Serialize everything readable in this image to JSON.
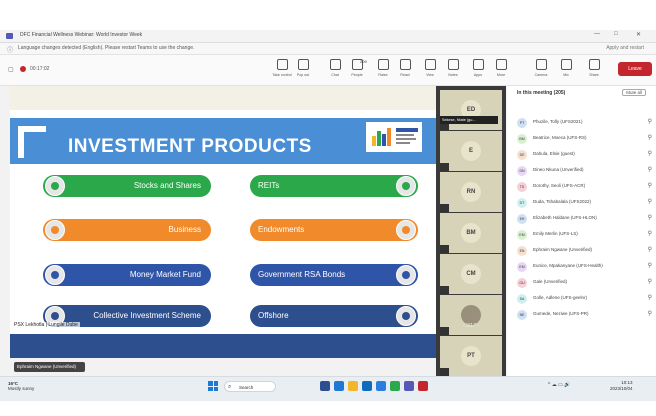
{
  "window": {
    "title": "DFC Financial Wellness Webinar: World Investor Week",
    "controls": [
      "—",
      "□",
      "✕"
    ]
  },
  "notice": {
    "text": "Language changes detected (English). Please restart Teams to use the change.",
    "action": "Apply and restart"
  },
  "meeting": {
    "timer": "00:17:02"
  },
  "toolbar": {
    "items": [
      {
        "label": "Take control",
        "icon": "take-control-icon"
      },
      {
        "label": "Pop out",
        "icon": "pop-out-icon"
      },
      {
        "label": "Chat",
        "icon": "chat-icon"
      },
      {
        "label": "People",
        "icon": "people-icon",
        "badge": "209"
      },
      {
        "label": "Raise",
        "icon": "raise-hand-icon"
      },
      {
        "label": "React",
        "icon": "react-icon"
      },
      {
        "label": "View",
        "icon": "view-icon"
      },
      {
        "label": "Notes",
        "icon": "notes-icon"
      },
      {
        "label": "Apps",
        "icon": "apps-icon"
      },
      {
        "label": "More",
        "icon": "more-icon"
      },
      {
        "label": "Camera",
        "icon": "camera-icon"
      },
      {
        "label": "Mic",
        "icon": "mic-icon"
      },
      {
        "label": "Share",
        "icon": "share-icon"
      }
    ],
    "leave_label": "Leave"
  },
  "slide": {
    "title": "INVESTMENT PRODUCTS",
    "products_left": [
      {
        "label": "Stocks and Shares",
        "color": "#2aa84a"
      },
      {
        "label": "Business",
        "color": "#f08a2a"
      },
      {
        "label": "Money Market Fund",
        "color": "#2f55a8"
      },
      {
        "label": "Collective Investment Scheme",
        "color": "#2e4f8d"
      }
    ],
    "products_right": [
      {
        "label": "REITs",
        "color": "#2aa84a"
      },
      {
        "label": "Endowments",
        "color": "#f08a2a"
      },
      {
        "label": "Government RSA Bonds",
        "color": "#2f55a8"
      },
      {
        "label": "Offshore",
        "color": "#2e4f8d"
      }
    ],
    "presenter": "PSX Lekhotla | Lungile Dube",
    "recording_name": "Ephraim Ngwane (Unverified)"
  },
  "tiles": [
    {
      "initials": "ED",
      "color": "#d7d3b8"
    },
    {
      "initials": "E",
      "color": "#d7d3b8"
    },
    {
      "initials": "RN",
      "color": "#d7d3b8"
    },
    {
      "initials": "BM",
      "color": "#d7d3b8"
    },
    {
      "initials": "CM",
      "color": "#d7d3b8"
    },
    {
      "initials": "",
      "color": "#d7d3b8"
    },
    {
      "initials": "PT",
      "color": "#d7d3b8"
    }
  ],
  "tile_name": "Sekese, Ntate (gu...",
  "pager": "‹  3/17  ›",
  "panel": {
    "heading": "In this meeting (205)",
    "mute_all": "Mute all",
    "participants": [
      {
        "initials": "PT",
        "name": "Phuzile, Tolly (UFS2021)"
      },
      {
        "initials": "BM",
        "name": "Beatrice, Moeca (UFS-RS)"
      },
      {
        "initials": "DE",
        "name": "Dahula, Elsie (guest)"
      },
      {
        "initials": "DN",
        "name": "Dineo Nkuna (Unverified)"
      },
      {
        "initials": "TS",
        "name": "Dorothy, Seoli (UFS-ACR)"
      },
      {
        "initials": "DT",
        "name": "Duda, Tshabalala (UFS2022)"
      },
      {
        "initials": "EH",
        "name": "Elizabeth Haldane (UFS-HLON)"
      },
      {
        "initials": "EM",
        "name": "Emily Merlin (UFS-LS)"
      },
      {
        "initials": "EN",
        "name": "Ephraim Ngwane (Unverified)"
      },
      {
        "initials": "EM",
        "name": "Eunice, Mpakanyane (UFS-Health)"
      },
      {
        "initials": "GU",
        "name": "Gale (Unverified)"
      },
      {
        "initials": "SA",
        "name": "Golle, Adlene (UFS-geelnr)"
      },
      {
        "initials": "NE",
        "name": "Gumede, Neziwe (UFS-PR)"
      }
    ]
  },
  "taskbar": {
    "weather": "16°C",
    "weather_sub": "Mostly sunny",
    "search_placeholder": "Search",
    "time": "10:13",
    "date": "2023/10/04"
  }
}
